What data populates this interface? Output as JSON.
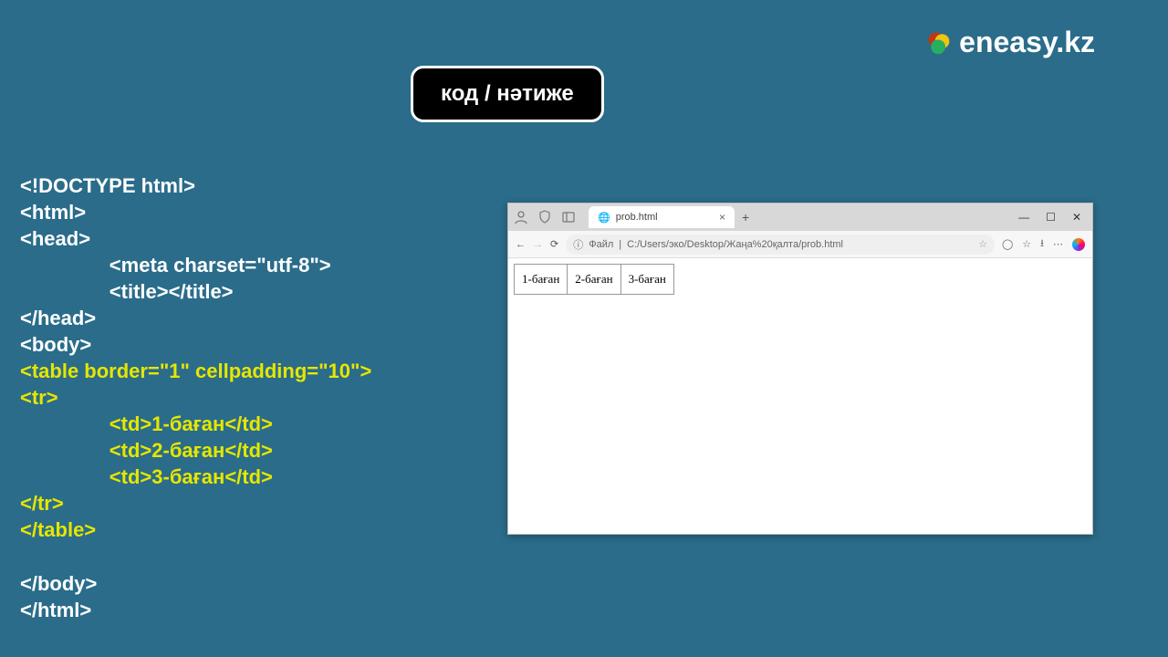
{
  "logo": {
    "text": "eneasy.kz"
  },
  "title_badge": "код / нәтиже",
  "code": {
    "l1": "<!DOCTYPE html>",
    "l2": "<html>",
    "l3": "<head>",
    "l4": "                <meta charset=\"utf-8\">",
    "l5": "                <title></title>",
    "l6": "</head>",
    "l7": "<body>",
    "l8": "<table border=\"1\" cellpadding=\"10\">",
    "l9": "<tr>",
    "l10": "                <td>1-баған</td>",
    "l11": "                <td>2-баған</td>",
    "l12": "                <td>3-баған</td>",
    "l13": "</tr>",
    "l14": "</table>",
    "l15": "",
    "l16": "</body>",
    "l17": "</html>"
  },
  "browser": {
    "tab_title": "prob.html",
    "addr_label": "Файл",
    "addr_path": "C:/Users/эко/Desktop/Жаңа%20қалта/prob.html"
  },
  "table": {
    "cells": [
      "1-баған",
      "2-баған",
      "3-баған"
    ]
  }
}
